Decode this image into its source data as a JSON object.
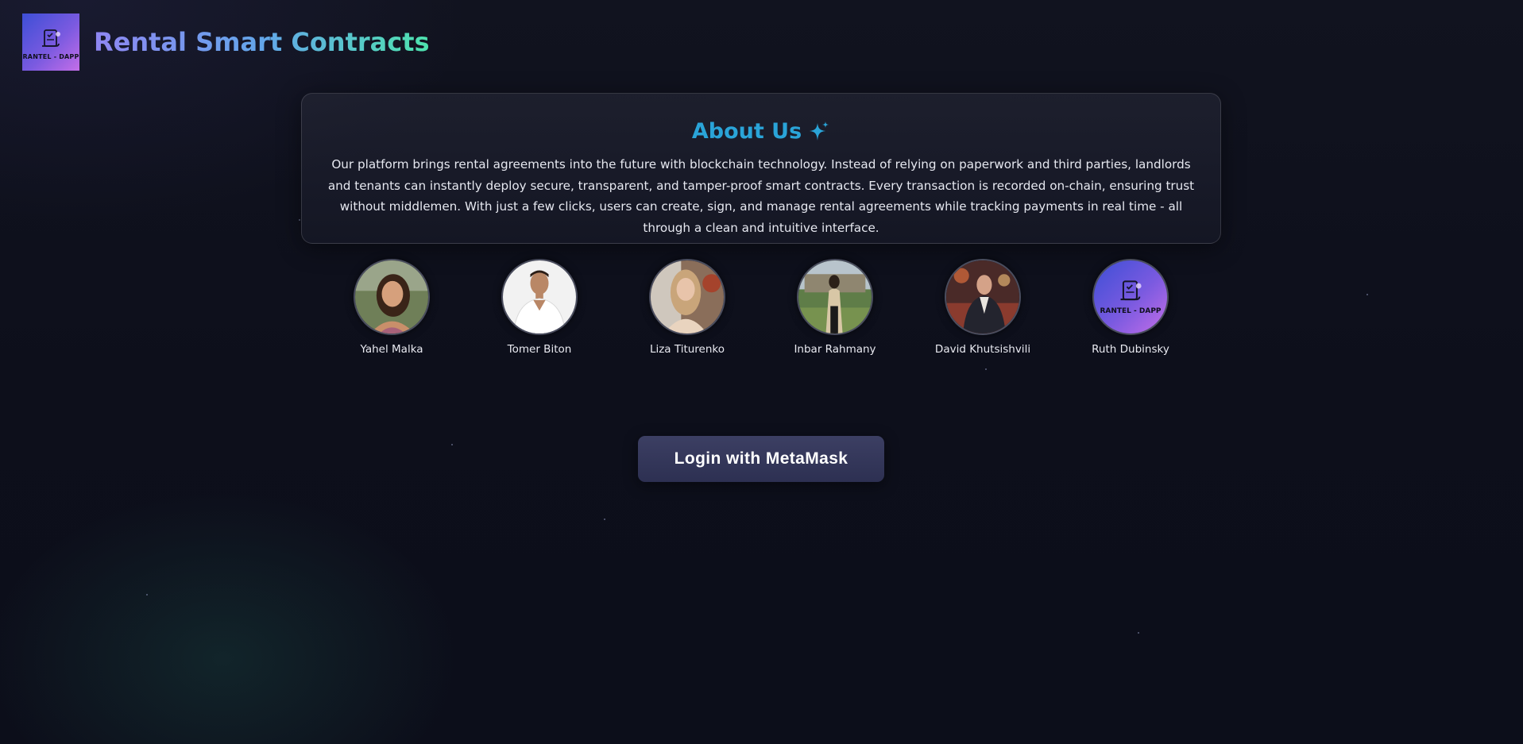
{
  "header": {
    "logo_text": "RANTEL - DAPP",
    "title": "Rental Smart Contracts"
  },
  "about": {
    "heading": "About Us",
    "heading_icon": "sparkles-icon",
    "text": "Our platform brings rental agreements into the future with blockchain technology. Instead of relying on paperwork and third parties, landlords and tenants can instantly deploy secure, transparent, and tamper-proof smart contracts. Every transaction is recorded on-chain, ensuring trust without middlemen. With just a few clicks, users can create, sign, and manage rental agreements while tracking payments in real time - all through a clean and intuitive interface."
  },
  "team": [
    {
      "name": "Yahel Malka"
    },
    {
      "name": "Tomer Biton"
    },
    {
      "name": "Liza Titurenko"
    },
    {
      "name": "Inbar Rahmany"
    },
    {
      "name": "David Khutsishvili"
    },
    {
      "name": "Ruth Dubinsky",
      "avatar_text": "RANTEL - DAPP"
    }
  ],
  "login": {
    "label": "Login with MetaMask"
  },
  "colors": {
    "background": "#0d0f1b",
    "about_heading": "#2aa4d8",
    "title_gradient_start": "#8f86f2",
    "title_gradient_end": "#4ee3ae",
    "button": "#35385a"
  }
}
